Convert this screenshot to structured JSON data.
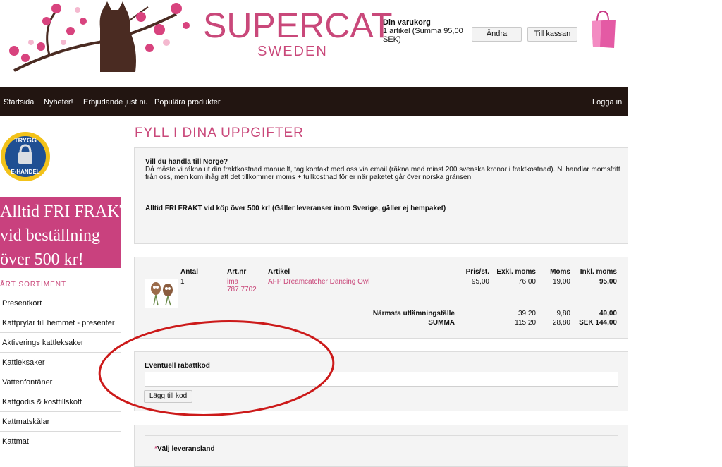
{
  "header": {
    "logo_main": "SUPERCAT",
    "logo_sub": "SWEDEN",
    "cart_title": "Din varukorg",
    "cart_summary": "1 artikel (Summa 95,00 SEK)",
    "change_button": "Ändra",
    "checkout_button": "Till kassan"
  },
  "nav": {
    "items": [
      "Startsida",
      "Nyheter!",
      "Erbjudande just nu",
      "Populära produkter"
    ],
    "login": "Logga in"
  },
  "sidebar": {
    "badge_line1": "TRYGG",
    "badge_line2": "E-HANDEL",
    "promo_lines": [
      "Alltid FRI FRAKT",
      "vid beställning",
      "över 500 kr!"
    ],
    "section_title": "ÅRT SORTIMENT",
    "items": [
      "Presentkort",
      "Kattprylar till hemmet - presenter",
      "Aktiverings kattleksaker",
      "Kattleksaker",
      "Vattenfontäner",
      "Kattgodis & kosttillskott",
      "Kattmatskålar",
      "Kattmat"
    ]
  },
  "main": {
    "title": "FYLL I DINA UPPGIFTER",
    "norway_title": "Vill du handla till Norge?",
    "norway_text": "Då måste vi räkna ut din fraktkostnad manuellt, tag kontakt med oss via email (räkna med minst 200 svenska kronor i fraktkostnad). Ni handlar momsfritt från oss, men kom ihåg att det tillkommer moms + tullkostnad för er när paketet går över norska gränsen.",
    "free_shipping": "Alltid FRI FRAKT vid köp över 500 kr! (Gäller leveranser inom Sverige, gäller ej hempaket)"
  },
  "cart": {
    "headers": {
      "antal": "Antal",
      "artnr": "Art.nr",
      "artikel": "Artikel",
      "pris": "Pris/st.",
      "exkl": "Exkl. moms",
      "moms": "Moms",
      "inkl": "Inkl. moms"
    },
    "row": {
      "antal": "1",
      "artnr": "ima 787.7702",
      "artikel": "AFP Dreamcatcher Dancing Owl",
      "pris": "95,00",
      "exkl": "76,00",
      "moms": "19,00",
      "inkl": "95,00"
    },
    "shipping": {
      "label": "Närmsta utlämningställe",
      "exkl": "39,20",
      "moms": "9,80",
      "inkl": "49,00"
    },
    "total": {
      "label": "SUMMA",
      "exkl": "115,20",
      "moms": "28,80",
      "inkl": "SEK 144,00"
    }
  },
  "rabatt": {
    "label": "Eventuell rabattkod",
    "input_value": "",
    "button": "Lägg till kod"
  },
  "land": {
    "required_mark": "*",
    "label": "Välj leveransland"
  },
  "colors": {
    "brand_pink": "#c9487a",
    "nav_bg": "#221511",
    "promo_bg": "#c9417e",
    "annotation_red": "#cc1a1a"
  }
}
